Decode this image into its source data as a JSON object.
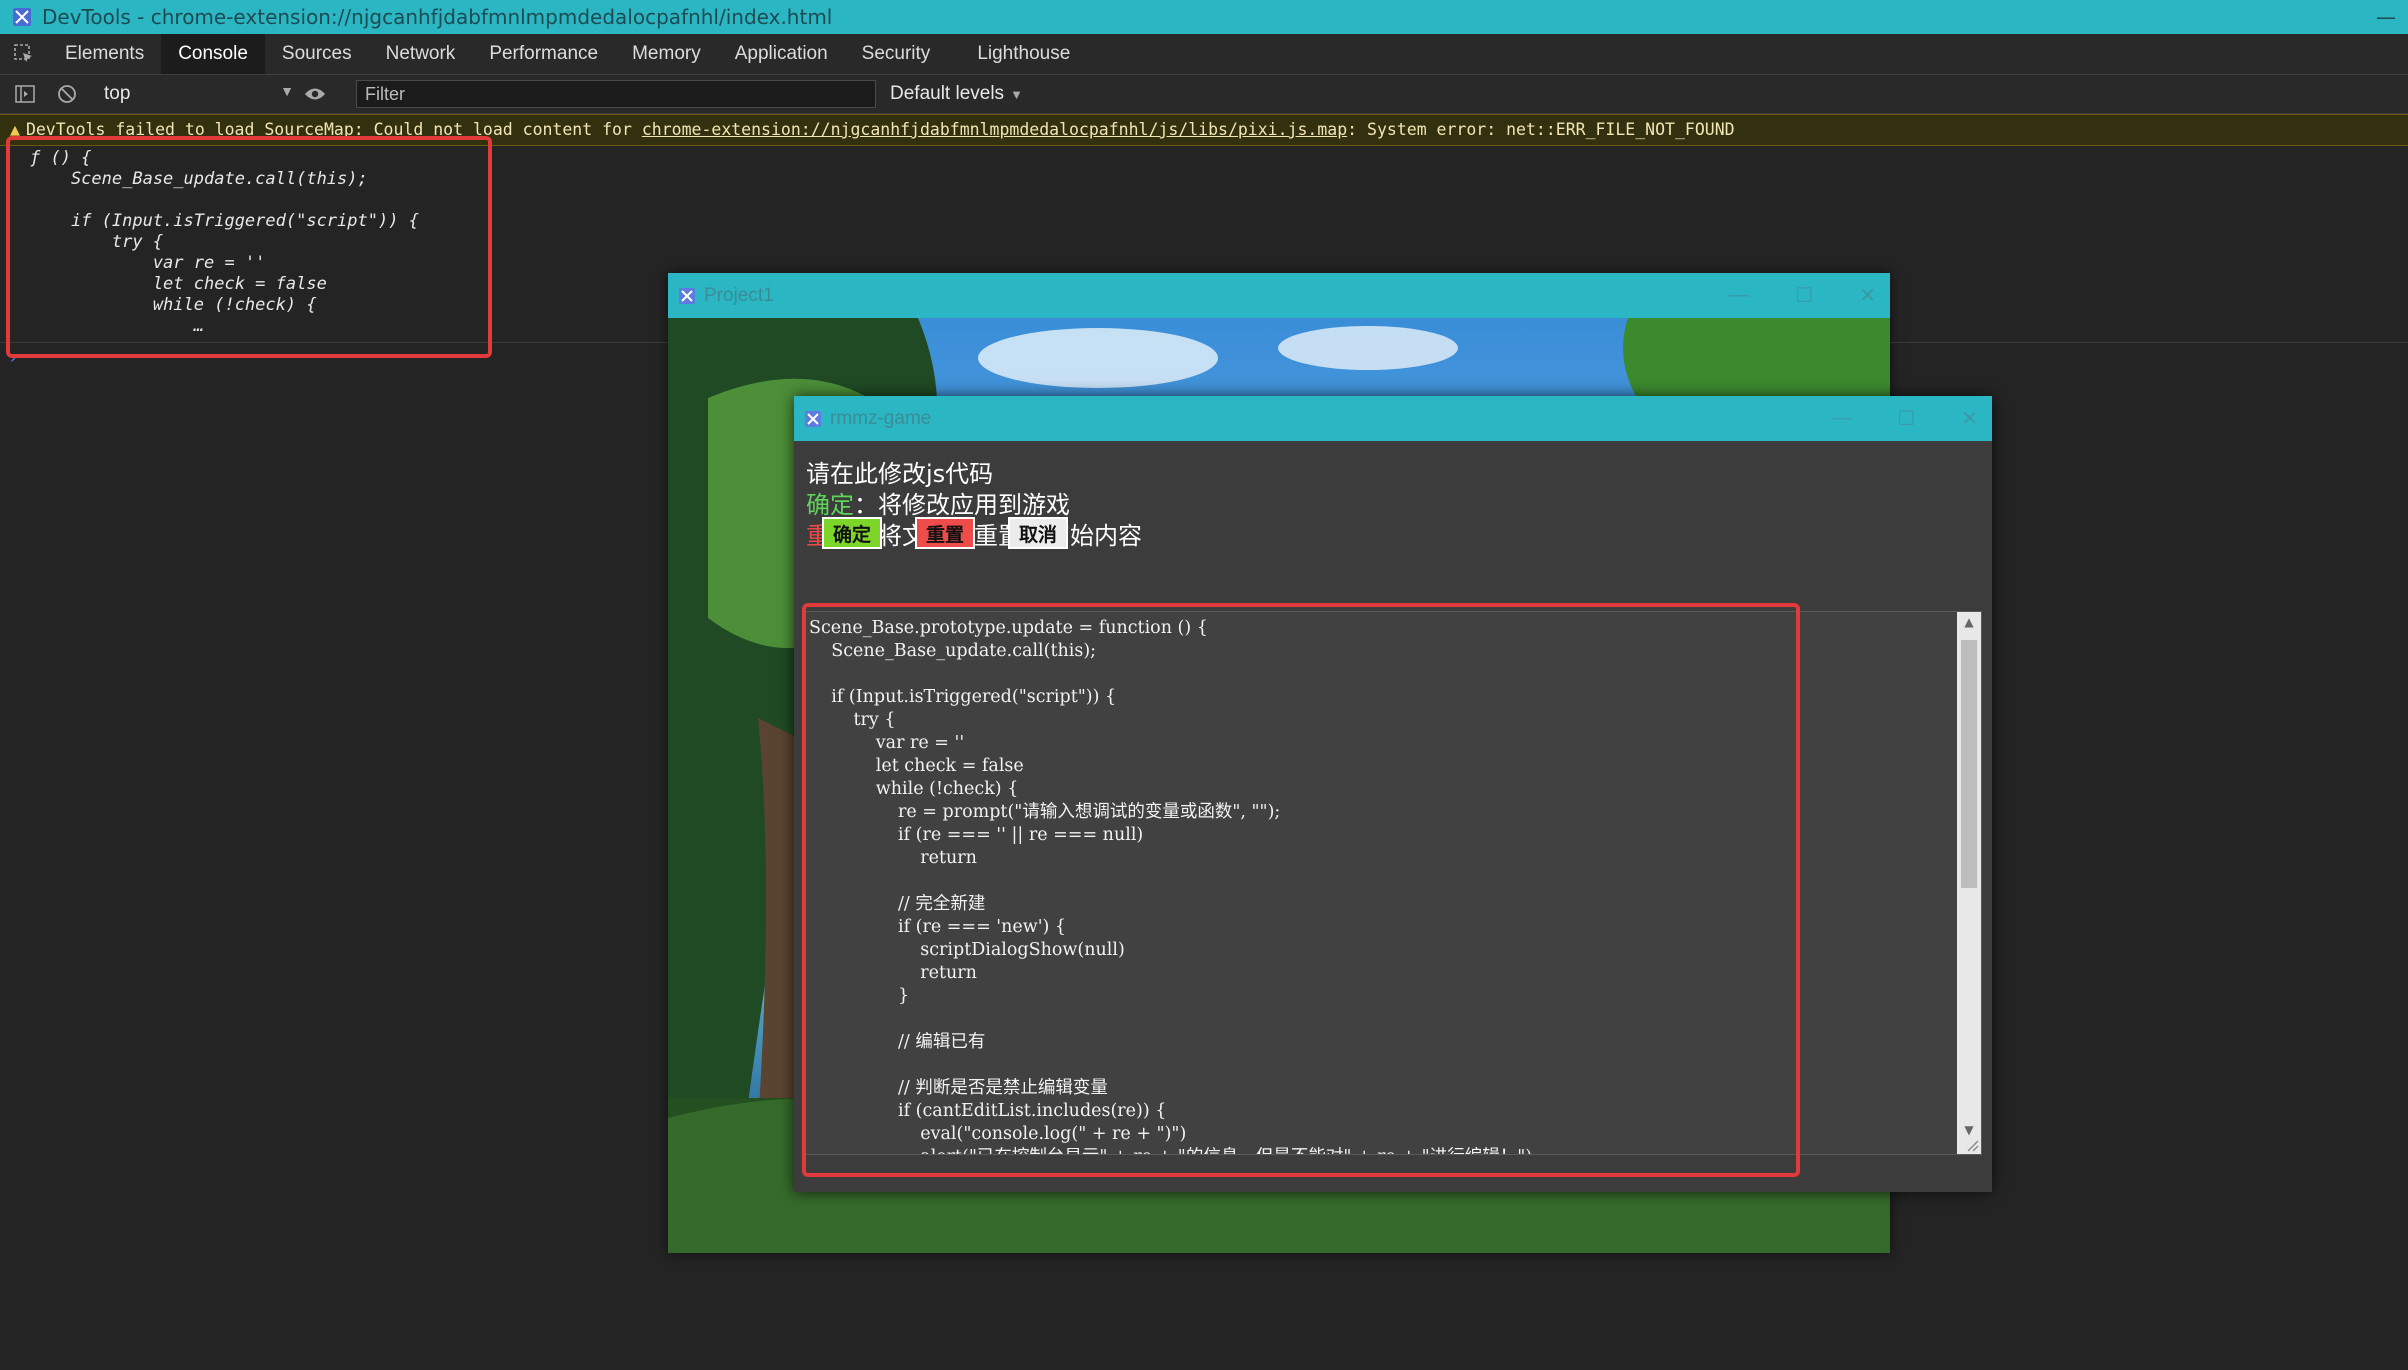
{
  "devtools": {
    "title": "DevTools - chrome-extension://njgcanhfjdabfmnlmpmdedalocpafnhl/index.html",
    "tabs": [
      "Elements",
      "Console",
      "Sources",
      "Network",
      "Performance",
      "Memory",
      "Application",
      "Security",
      "Lighthouse"
    ],
    "active_tab": "Console",
    "context": "top",
    "filter_placeholder": "Filter",
    "levels": "Default levels"
  },
  "warning": {
    "prefix": "DevTools failed to load SourceMap: Could not load content for ",
    "link": "chrome-extension://njgcanhfjdabfmnlmpmdedalocpafnhl/js/libs/pixi.js.map",
    "suffix": ": System error: net::ERR_FILE_NOT_FOUND"
  },
  "console_output": "ƒ () {\n    Scene_Base_update.call(this);\n\n    if (Input.isTriggered(\"script\")) {\n        try {\n            var re = ''\n            let check = false\n            while (!check) {\n                …",
  "project_window": {
    "title": "Project1"
  },
  "dialog": {
    "title": "rmmz-game",
    "heading": "请在此修改js代码",
    "confirm_label": "确定",
    "confirm_desc": "：将修改应用到游戏",
    "reset_label": "重置",
    "reset_desc": "：将文本框重置为初始内容",
    "buttons": {
      "confirm": "确定",
      "reset": "重置",
      "cancel": "取消"
    },
    "code": "Scene_Base.prototype.update = function () {\n    Scene_Base_update.call(this);\n\n    if (Input.isTriggered(\"script\")) {\n        try {\n            var re = ''\n            let check = false\n            while (!check) {\n                re = prompt(\"请输入想调试的变量或函数\", \"\");\n                if (re === '' || re === null)\n                    return\n\n                // 完全新建\n                if (re === 'new') {\n                    scriptDialogShow(null)\n                    return\n                }\n\n                // 编辑已有\n\n                // 判断是否是禁止编辑变量\n                if (cantEditList.includes(re)) {\n                    eval(\"console.log(\" + re + \")\")\n                    alert(\"已在控制台显示\" + re + \"的信息，但是不能对\" + re + \"进行编辑！\")"
  },
  "colors": {
    "titlebar": "#2ab6c3",
    "confirm": "#7ed52a",
    "reset": "#ee4b4b",
    "highlight": "#e23a3a"
  }
}
